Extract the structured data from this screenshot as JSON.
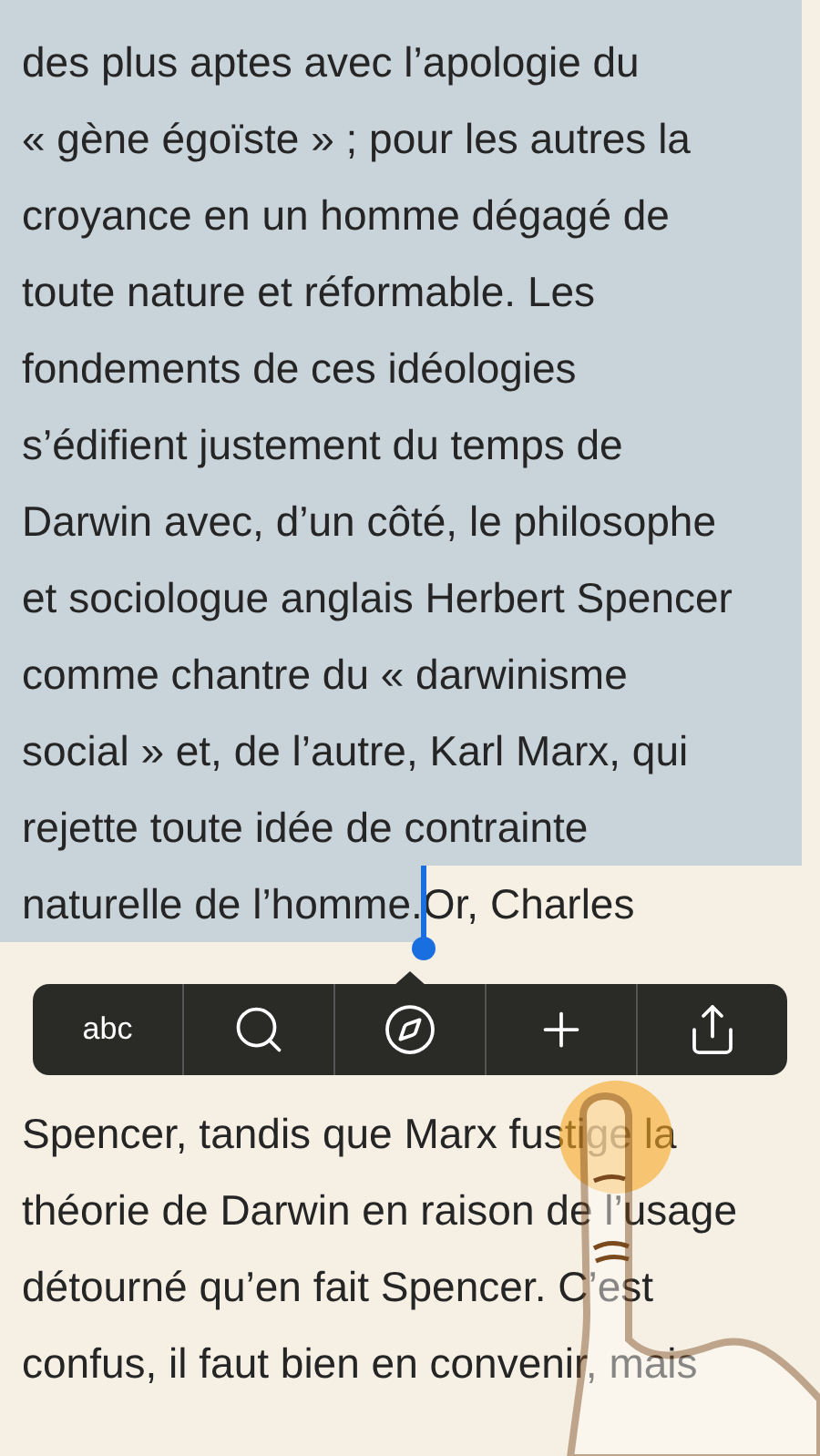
{
  "page": {
    "lines_before_menu": [
      {
        "segments": [
          {
            "text": "des plus aptes avec l’apologie du",
            "selected": true
          }
        ]
      },
      {
        "segments": [
          {
            "text": "« gène égoïste » ; pour les autres la",
            "selected": true
          }
        ]
      },
      {
        "segments": [
          {
            "text": "croyance en un homme dégagé de",
            "selected": true
          }
        ]
      },
      {
        "segments": [
          {
            "text": "toute nature et réformable. Les",
            "selected": true
          }
        ]
      },
      {
        "segments": [
          {
            "text": "fondements de ces idéologies",
            "selected": true
          }
        ]
      },
      {
        "segments": [
          {
            "text": "s’édifient justement du temps de",
            "selected": true
          }
        ]
      },
      {
        "segments": [
          {
            "text": "Darwin avec, d’un côté, le philosophe",
            "selected": true
          }
        ]
      },
      {
        "segments": [
          {
            "text": "et sociologue anglais Herbert Spencer",
            "selected": true
          }
        ]
      },
      {
        "segments": [
          {
            "text": "comme chantre du « darwinisme",
            "selected": true
          }
        ]
      },
      {
        "segments": [
          {
            "text": "social » et, de l’autre, Karl Marx, qui",
            "selected": true
          }
        ]
      },
      {
        "segments": [
          {
            "text": "rejette toute idée de contrainte",
            "selected": true
          }
        ]
      },
      {
        "segments": [
          {
            "text": "naturelle de l’homme.",
            "selected": true
          },
          {
            "text": " Or, Charles",
            "selected": false
          }
        ]
      }
    ],
    "lines_after_menu": [
      {
        "segments": [
          {
            "text": "Spencer, tandis que Marx fustige la",
            "selected": false
          }
        ]
      },
      {
        "segments": [
          {
            "text": "théorie de Darwin en raison de l’usage",
            "selected": false
          }
        ]
      },
      {
        "segments": [
          {
            "text": "détourné qu’en fait Spencer. C’est",
            "selected": false
          }
        ]
      },
      {
        "segments": [
          {
            "text": "confus, il faut bien en convenir, mais",
            "selected": false
          }
        ]
      }
    ]
  },
  "edit_menu": {
    "items": [
      {
        "kind": "text",
        "label": "abc"
      },
      {
        "kind": "search"
      },
      {
        "kind": "compass"
      },
      {
        "kind": "add"
      },
      {
        "kind": "share"
      }
    ]
  }
}
